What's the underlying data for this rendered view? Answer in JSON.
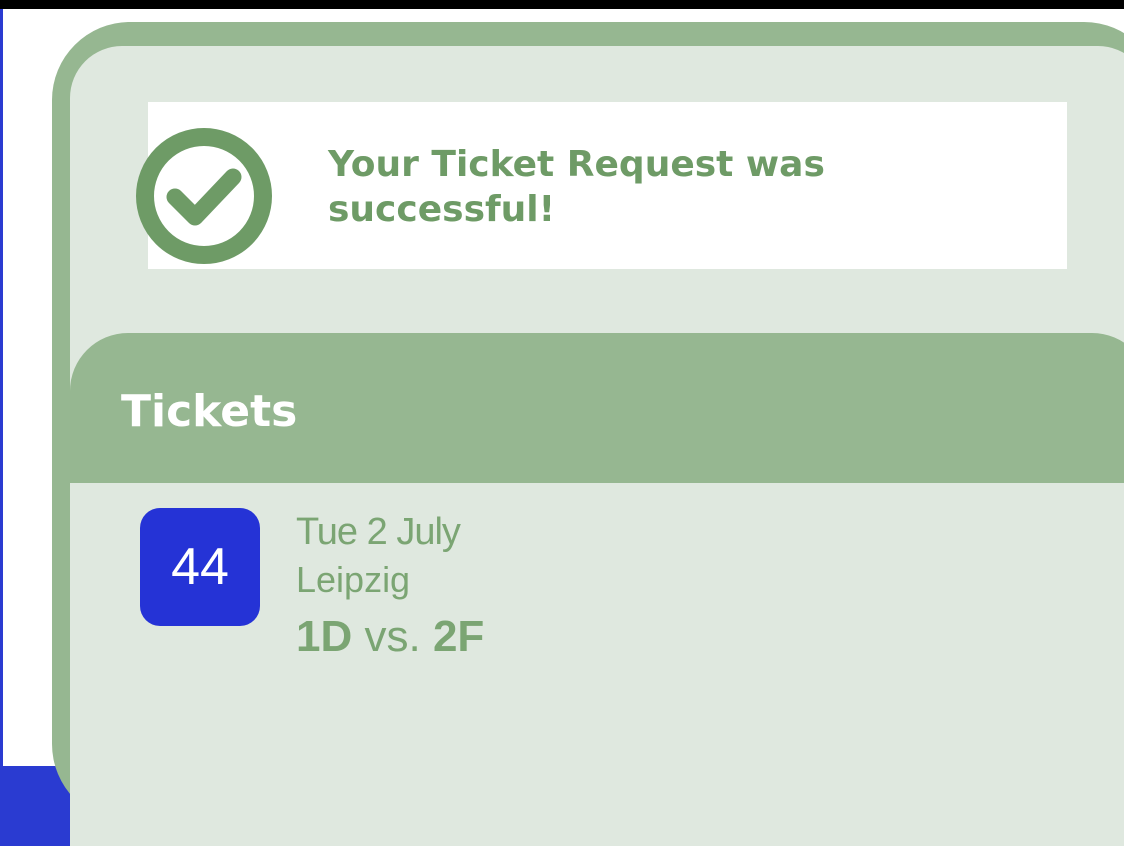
{
  "colors": {
    "frame_green": "#96b791",
    "panel_bg": "#dfe8df",
    "accent_green": "#6e9b66",
    "badge_blue": "#2533d6",
    "device_border_blue": "#2a3bd1"
  },
  "confirmation": {
    "icon": "check-circle-icon",
    "message": "Your Ticket Request was successful!"
  },
  "tickets": {
    "title": "Tickets",
    "items": [
      {
        "match_number": "44",
        "date": "Tue 2 July",
        "venue": "Leipzig",
        "home": "1D",
        "vs": "vs.",
        "away": "2F"
      }
    ]
  }
}
